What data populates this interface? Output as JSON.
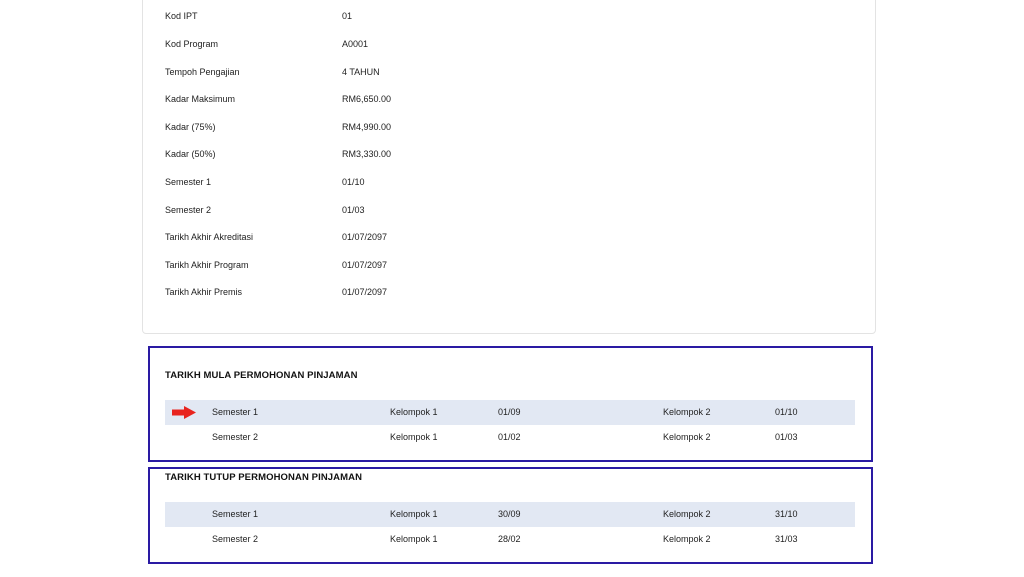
{
  "program_info": [
    {
      "label": "Kod IPT",
      "value": "01"
    },
    {
      "label": "Kod Program",
      "value": "A0001"
    },
    {
      "label": "Tempoh Pengajian",
      "value": "4 TAHUN"
    },
    {
      "label": "Kadar Maksimum",
      "value": "RM6,650.00"
    },
    {
      "label": "Kadar (75%)",
      "value": "RM4,990.00"
    },
    {
      "label": "Kadar (50%)",
      "value": "RM3,330.00"
    },
    {
      "label": "Semester 1",
      "value": "01/10"
    },
    {
      "label": "Semester 2",
      "value": "01/03"
    },
    {
      "label": "Tarikh Akhir Akreditasi",
      "value": "01/07/2097"
    },
    {
      "label": "Tarikh Akhir Program",
      "value": "01/07/2097"
    },
    {
      "label": "Tarikh Akhir Premis",
      "value": "01/07/2097"
    }
  ],
  "open_dates": {
    "title": "TARIKH MULA PERMOHONAN PINJAMAN",
    "rows": [
      {
        "semester": "Semester 1",
        "group1": "Kelompok 1",
        "date1": "01/09",
        "group2": "Kelompok 2",
        "date2": "01/10"
      },
      {
        "semester": "Semester 2",
        "group1": "Kelompok 1",
        "date1": "01/02",
        "group2": "Kelompok 2",
        "date2": "01/03"
      }
    ]
  },
  "close_dates": {
    "title": "TARIKH TUTUP PERMOHONAN PINJAMAN",
    "rows": [
      {
        "semester": "Semester 1",
        "group1": "Kelompok 1",
        "date1": "30/09",
        "group2": "Kelompok 2",
        "date2": "31/10"
      },
      {
        "semester": "Semester 2",
        "group1": "Kelompok 1",
        "date1": "28/02",
        "group2": "Kelompok 2",
        "date2": "31/03"
      }
    ]
  },
  "colors": {
    "highlight_border": "#2a1aa3",
    "row_shade": "#e2e8f3",
    "arrow": "#e8231e"
  },
  "icons": {
    "pointer": "red-right-arrow-icon"
  }
}
